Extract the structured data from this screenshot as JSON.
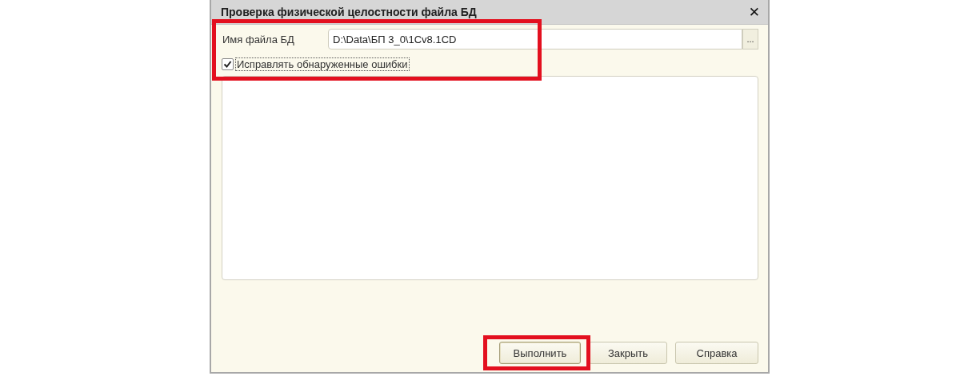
{
  "window": {
    "title": "Проверка физической целостности файла БД",
    "close": "✕"
  },
  "file_field": {
    "label": "Имя файла БД",
    "value": "D:\\Data\\БП 3_0\\1Cv8.1CD",
    "browse": "..."
  },
  "fix_errors": {
    "label": "Исправлять обнаруженные ошибки",
    "checked": true
  },
  "buttons": [
    {
      "label": "Выполнить",
      "selected": true
    },
    {
      "label": "Закрыть",
      "selected": false
    },
    {
      "label": "Справка",
      "selected": false
    }
  ]
}
